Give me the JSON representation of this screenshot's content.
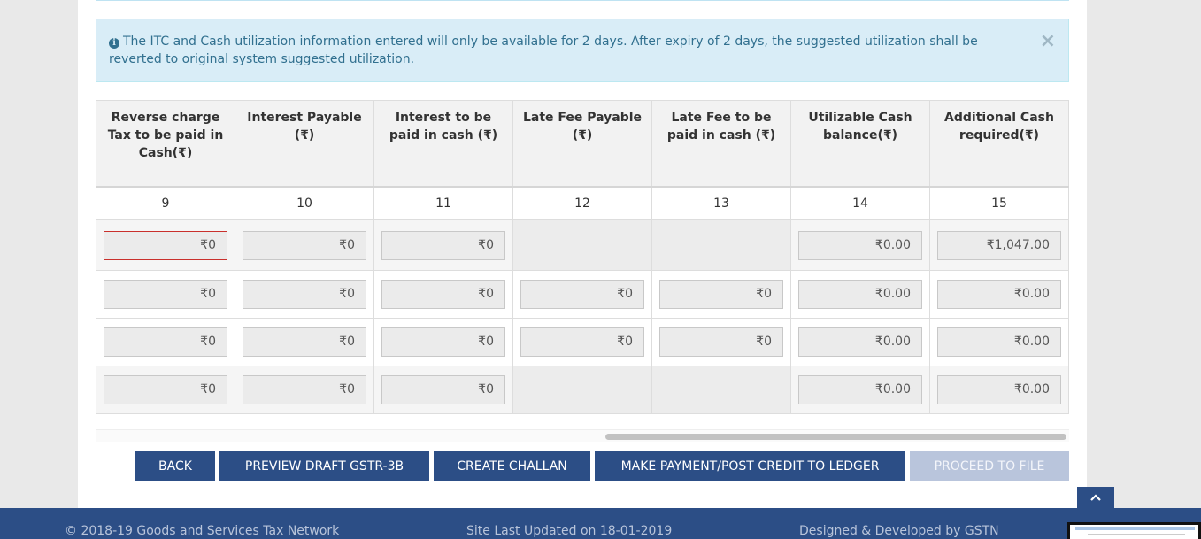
{
  "alert": {
    "text": "The ITC and Cash utilization information entered will only be available for 2 days. After expiry of 2 days, the suggested utilization shall be reverted to original system suggested utilization.",
    "close": "×"
  },
  "table": {
    "headers": [
      "Reverse charge Tax to be paid in Cash(₹)",
      "Interest Payable (₹)",
      "Interest to be paid in cash (₹)",
      "Late Fee Payable (₹)",
      "Late Fee to be paid in cash (₹)",
      "Utilizable Cash balance(₹)",
      "Additional Cash required(₹)"
    ],
    "numbers": [
      "9",
      "10",
      "11",
      "12",
      "13",
      "14",
      "15"
    ],
    "rows": [
      [
        "₹0",
        "₹0",
        "₹0",
        null,
        null,
        "₹0.00",
        "₹1,047.00"
      ],
      [
        "₹0",
        "₹0",
        "₹0",
        "₹0",
        "₹0",
        "₹0.00",
        "₹0.00"
      ],
      [
        "₹0",
        "₹0",
        "₹0",
        "₹0",
        "₹0",
        "₹0.00",
        "₹0.00"
      ],
      [
        "₹0",
        "₹0",
        "₹0",
        null,
        null,
        "₹0.00",
        "₹0.00"
      ]
    ]
  },
  "buttons": {
    "back": "BACK",
    "preview": "PREVIEW DRAFT GSTR-3B",
    "challan": "CREATE CHALLAN",
    "payment": "MAKE PAYMENT/POST CREDIT TO LEDGER",
    "proceed": "PROCEED TO FILE"
  },
  "footer": {
    "copyright": "© 2018-19 Goods and Services Tax Network",
    "updated": "Site Last Updated on 18-01-2019",
    "designed": "Designed & Developed by GSTN"
  },
  "icons": {
    "info": "info-circle-icon",
    "close": "close-icon",
    "scroll_top": "chevron-up-icon"
  },
  "colors": {
    "primary": "#2c4e86",
    "alert_bg": "#d9edf7",
    "alert_text": "#31708f",
    "error_border": "#c9302c"
  }
}
